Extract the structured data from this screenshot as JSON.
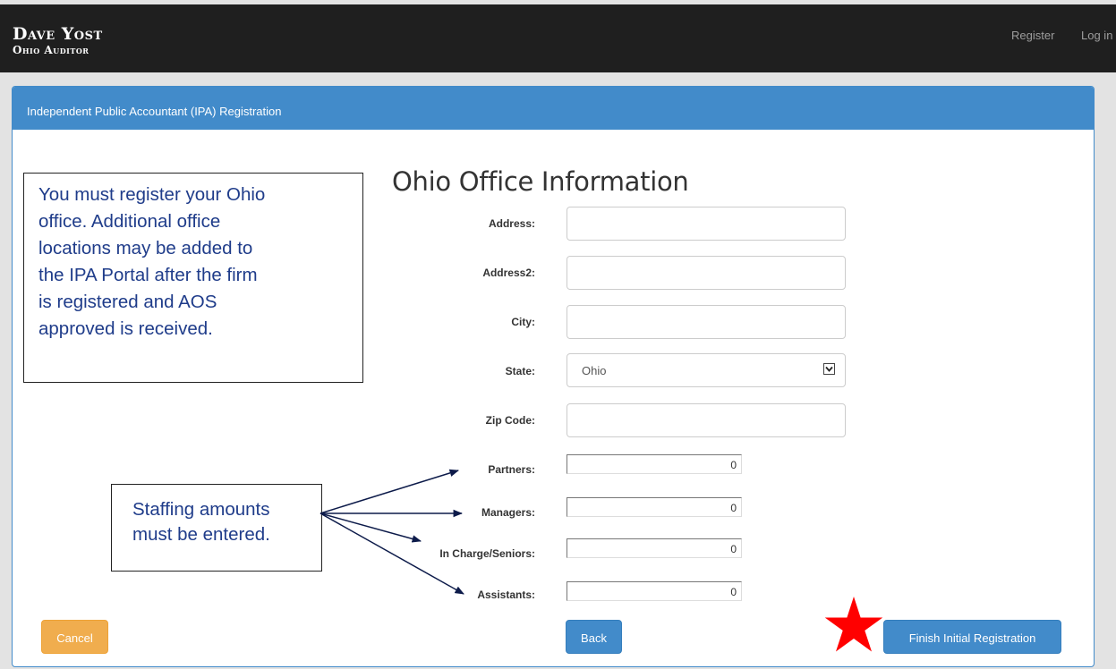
{
  "header": {
    "logo_name": "Dave Yost",
    "logo_title": "Ohio Auditor",
    "nav": [
      {
        "label": "Register"
      },
      {
        "label": "Log in"
      }
    ],
    "bg_color": "#1f1f1f"
  },
  "panel": {
    "title": "Independent Public Accountant (IPA) Registration",
    "accent_color": "#428bca"
  },
  "annotations": {
    "office_note": "You must register your Ohio office.  Additional office locations may be added to the IPA Portal after the firm is registered and AOS approved is received.",
    "office_note_lines": [
      "You must register your Ohio",
      "office.  Additional office",
      "locations may be added to",
      "the IPA Portal after the firm",
      "is registered and AOS",
      "approved is received."
    ],
    "staffing_note_lines": [
      "Staffing amounts",
      "must be entered."
    ],
    "star_color": "#ff0000"
  },
  "form": {
    "heading": "Ohio Office Information",
    "fields": {
      "address": {
        "label": "Address:",
        "value": ""
      },
      "address2": {
        "label": "Address2:",
        "value": ""
      },
      "city": {
        "label": "City:",
        "value": ""
      },
      "state": {
        "label": "State:",
        "value": "Ohio"
      },
      "zip": {
        "label": "Zip Code:",
        "value": ""
      }
    },
    "staffing": {
      "partners": {
        "label": "Partners:",
        "value": "0"
      },
      "managers": {
        "label": "Managers:",
        "value": "0"
      },
      "seniors": {
        "label": "In Charge/Seniors:",
        "value": "0"
      },
      "assistants": {
        "label": "Assistants:",
        "value": "0"
      }
    }
  },
  "buttons": {
    "cancel": {
      "label": "Cancel",
      "color": "#f0ad4e"
    },
    "back": {
      "label": "Back",
      "color": "#428bca"
    },
    "finish": {
      "label": "Finish Initial Registration",
      "color": "#428bca"
    }
  }
}
